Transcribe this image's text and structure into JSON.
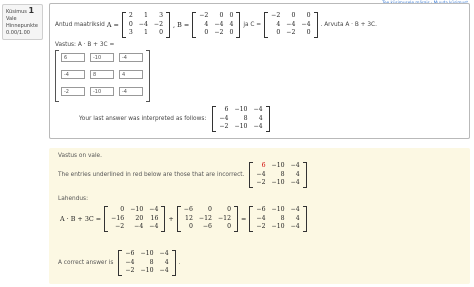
{
  "info": {
    "question_label": "Küsimus",
    "question_number": "1",
    "status": "Vale",
    "grade_label": "Hinnepunkte",
    "grade_value": "0.00/1.00"
  },
  "flag": {
    "text": "Tee küsimusele märgis · Muuda küsimust"
  },
  "question": {
    "prefix": "Antud maatriksid",
    "A_label": "A =",
    "B_label": ", B =",
    "C_label": "ja C =",
    "task": ". Arvuta A · B + 3C.",
    "A": [
      [
        "2",
        "1",
        "3"
      ],
      [
        "0",
        "−4",
        "−2"
      ],
      [
        "3",
        "1",
        "0"
      ]
    ],
    "B": [
      [
        "−2",
        "0",
        "0"
      ],
      [
        "4",
        "−4",
        "4"
      ],
      [
        "0",
        "−2",
        "0"
      ]
    ],
    "C": [
      [
        "−2",
        "0",
        "0"
      ],
      [
        "4",
        "−4",
        "−4"
      ],
      [
        "0",
        "−2",
        "0"
      ]
    ]
  },
  "answer": {
    "label": "Vastus: A · B + 3C =",
    "cells": [
      "6",
      "-10",
      "-4",
      "-4",
      "8",
      "4",
      "-2",
      "-10",
      "-4"
    ]
  },
  "interpretation": {
    "text": "Your last answer was interpreted as follows:",
    "matrix": [
      [
        "6",
        "−10",
        "−4"
      ],
      [
        "−4",
        "8",
        "4"
      ],
      [
        "−2",
        "−10",
        "−4"
      ]
    ]
  },
  "feedback": {
    "status": "Vastus on vale.",
    "underline_text": "The entries underlined in red below are those that are incorrect.",
    "marked": [
      [
        "6",
        "−10",
        "−4"
      ],
      [
        "−4",
        "8",
        "4"
      ],
      [
        "−2",
        "−10",
        "−4"
      ]
    ],
    "solution_label": "Lahendus:",
    "lhs": "A · B + 3C =",
    "m1": [
      [
        "0",
        "−10",
        "−4"
      ],
      [
        "−16",
        "20",
        "16"
      ],
      [
        "−2",
        "−4",
        "−4"
      ]
    ],
    "m2": [
      [
        "−6",
        "0",
        "0"
      ],
      [
        "12",
        "−12",
        "−12"
      ],
      [
        "0",
        "−6",
        "0"
      ]
    ],
    "m3": [
      [
        "−6",
        "−10",
        "−4"
      ],
      [
        "−4",
        "8",
        "4"
      ],
      [
        "−2",
        "−10",
        "−4"
      ]
    ],
    "correct_text": "A correct answer is",
    "correct": [
      [
        "−6",
        "−10",
        "−4"
      ],
      [
        "−4",
        "8",
        "4"
      ],
      [
        "−2",
        "−10",
        "−4"
      ]
    ]
  },
  "colors": {
    "feedback_bg": "#fcf8e3",
    "incorrect": "#d00000"
  }
}
